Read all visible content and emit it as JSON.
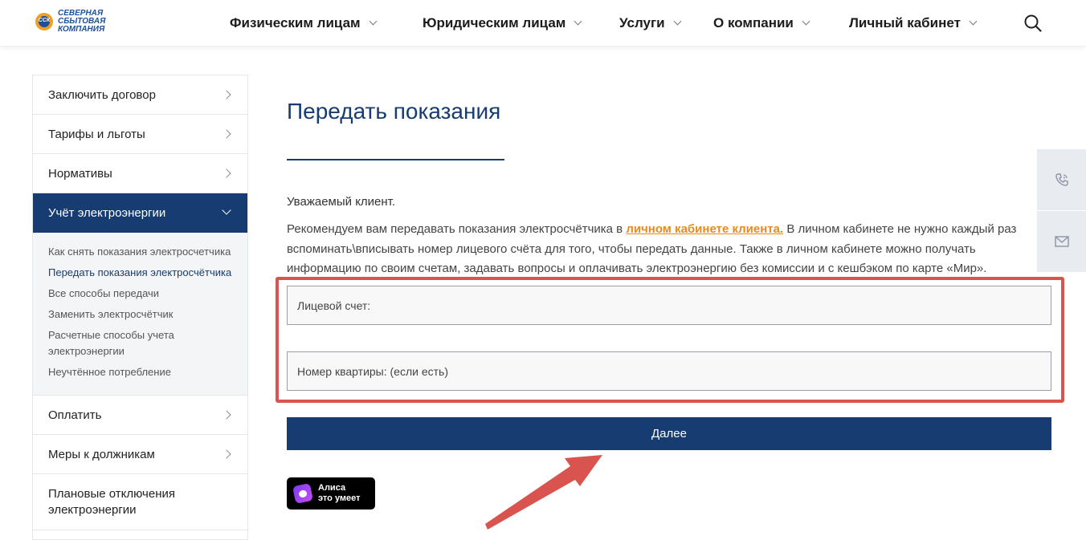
{
  "logo": {
    "mark_text": "ССК",
    "lines": [
      "СЕВЕРНАЯ",
      "СБЫТОВАЯ",
      "КОМПАНИЯ"
    ]
  },
  "nav": [
    {
      "label": "Физическим лицам"
    },
    {
      "label": "Юридическим лицам"
    },
    {
      "label": "Услуги"
    },
    {
      "label": "О компании"
    },
    {
      "label": "Личный кабинет"
    }
  ],
  "sidebar": {
    "items": [
      {
        "label": "Заключить договор"
      },
      {
        "label": "Тарифы и льготы"
      },
      {
        "label": "Нормативы"
      },
      {
        "label": "Учёт электроэнергии"
      }
    ],
    "submenu": [
      "Как снять показания электросчетчика",
      "Передать показания электросчётчика",
      "Все способы передачи",
      "Заменить электросчётчик",
      "Расчетные способы учета электроэнергии",
      "Неучтённое потребление"
    ],
    "items_after": [
      {
        "label": "Оплатить"
      },
      {
        "label": "Меры к должникам"
      },
      {
        "label": "Плановые отключения электроэнергии"
      }
    ]
  },
  "main": {
    "title": "Передать показания",
    "greeting": "Уважаемый клиент.",
    "para_before_link": "Рекомендуем вам передавать показания электросчётчика в ",
    "link_text": "личном кабинете клиента.",
    "para_after_link": " В личном кабинете не нужно каждый раз вспоминать\\вписывать номер лицевого счёта для того, чтобы передать данные. Также в личном кабинете можно получать информацию по своим счетам, задавать вопросы и оплачивать электроэнергию без комиссии и с кешбэком по карте «Мир».",
    "field_account_placeholder": "Лицевой счет:",
    "field_apartment_placeholder": "Номер квартиры: (если есть)",
    "next_button": "Далее",
    "alice_line1": "Алиса",
    "alice_line2": "это умеет"
  },
  "colors": {
    "brand_blue": "#163c72",
    "link_orange": "#e98b1a",
    "annotation_red": "#d9534f"
  }
}
